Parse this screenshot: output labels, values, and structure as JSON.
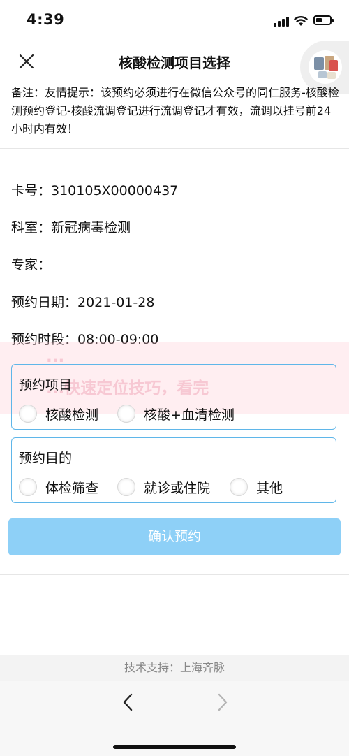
{
  "status_bar": {
    "time": "4:39"
  },
  "header": {
    "title": "核酸检测项目选择"
  },
  "notice": {
    "text": "备注：友情提示：该预约必须进行在微信公众号的同仁服务-核酸检测预约登记-核酸流调登记进行流调登记才有效，流调以挂号前24小时内有效！"
  },
  "info": {
    "card": "卡号：310105X00000437",
    "department": "科室：新冠病毒检测",
    "expert": "专家：",
    "date": "预约日期：2021-01-28",
    "time_slot": "预约时段：08:00-09:00"
  },
  "watermark": {
    "line1": "...",
    "line2": "...快速定位技巧，看完"
  },
  "appointment_item": {
    "title": "预约项目",
    "options": [
      "核酸检测",
      "核酸+血清检测"
    ]
  },
  "appointment_purpose": {
    "title": "预约目的",
    "options": [
      "体检筛查",
      "就诊或住院",
      "其他"
    ]
  },
  "confirm_button": {
    "label": "确认预约"
  },
  "footer": {
    "support": "技术支持：上海齐脉"
  },
  "colors": {
    "accent": "#5fb6e9",
    "button": "#8ed0f7"
  }
}
